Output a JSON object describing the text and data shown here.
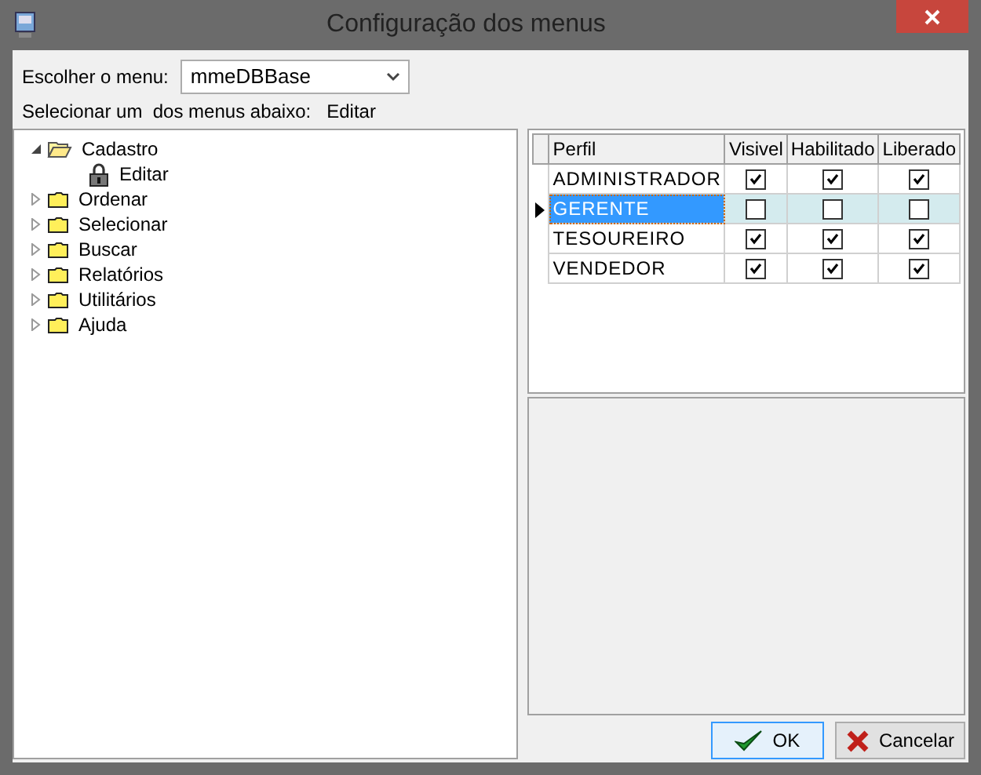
{
  "window": {
    "title": "Configuração dos menus"
  },
  "menu_select": {
    "label": "Escolher o menu:",
    "value": "mmeDBBase"
  },
  "selection": {
    "label": "Selecionar um  dos menus abaixo:",
    "value": "Editar"
  },
  "tree": [
    {
      "label": "Cadastro",
      "kind": "folder",
      "expanded": true,
      "children": [
        {
          "label": "Editar",
          "kind": "locked"
        }
      ]
    },
    {
      "label": "Ordenar",
      "kind": "folder",
      "expanded": false
    },
    {
      "label": "Selecionar",
      "kind": "folder",
      "expanded": false
    },
    {
      "label": "Buscar",
      "kind": "folder",
      "expanded": false
    },
    {
      "label": "Relatórios",
      "kind": "folder",
      "expanded": false
    },
    {
      "label": "Utilitários",
      "kind": "folder",
      "expanded": false
    },
    {
      "label": "Ajuda",
      "kind": "folder",
      "expanded": false
    }
  ],
  "table": {
    "columns": [
      "Perfil",
      "Visivel",
      "Habilitado",
      "Liberado"
    ],
    "rows": [
      {
        "perfil": "ADMINISTRADOR",
        "visivel": true,
        "habilitado": true,
        "liberado": true,
        "selected": false
      },
      {
        "perfil": "GERENTE",
        "visivel": false,
        "habilitado": false,
        "liberado": false,
        "selected": true
      },
      {
        "perfil": "TESOUREIRO",
        "visivel": true,
        "habilitado": true,
        "liberado": true,
        "selected": false
      },
      {
        "perfil": "VENDEDOR",
        "visivel": true,
        "habilitado": true,
        "liberado": true,
        "selected": false
      }
    ]
  },
  "buttons": [
    {
      "label": "OK",
      "kind": "ok",
      "default": true
    },
    {
      "label": "Cancelar",
      "kind": "cancel",
      "default": false
    }
  ]
}
